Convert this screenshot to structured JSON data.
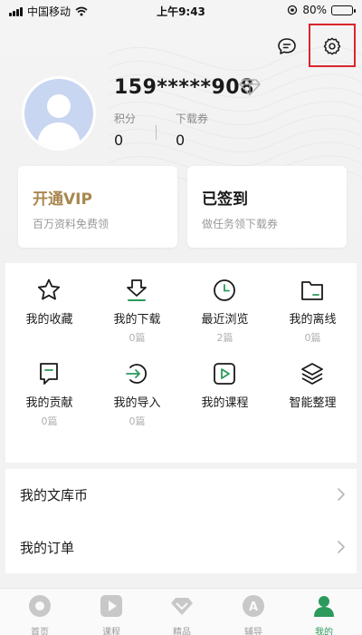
{
  "status_bar": {
    "carrier": "中国移动",
    "time": "上午9:43",
    "battery": "80%",
    "battery_fraction": 0.8
  },
  "header": {
    "message_icon": "chat-bubble-icon",
    "settings_icon": "gear-icon"
  },
  "profile": {
    "username": "159*****908",
    "stats": [
      {
        "label": "积分",
        "value": "0"
      },
      {
        "label": "下载券",
        "value": "0"
      }
    ]
  },
  "cards": {
    "vip": {
      "title": "开通VIP",
      "subtitle": "百万资料免费领"
    },
    "signin": {
      "title": "已签到",
      "subtitle": "做任务领下载券"
    }
  },
  "grid": [
    {
      "name": "我的收藏",
      "count": "",
      "icon": "star-icon"
    },
    {
      "name": "我的下载",
      "count": "0篇",
      "icon": "download-icon"
    },
    {
      "name": "最近浏览",
      "count": "2篇",
      "icon": "clock-icon"
    },
    {
      "name": "我的离线",
      "count": "0篇",
      "icon": "folder-icon"
    },
    {
      "name": "我的贡献",
      "count": "0篇",
      "icon": "contribution-icon"
    },
    {
      "name": "我的导入",
      "count": "0篇",
      "icon": "import-icon"
    },
    {
      "name": "我的课程",
      "count": "",
      "icon": "play-icon"
    },
    {
      "name": "智能整理",
      "count": "",
      "icon": "layers-icon"
    }
  ],
  "list": [
    {
      "label": "我的文库币"
    },
    {
      "label": "我的订单"
    }
  ],
  "tabs": [
    {
      "label": "首页",
      "icon": "home-icon",
      "active": false
    },
    {
      "label": "课程",
      "icon": "course-icon",
      "active": false
    },
    {
      "label": "精品",
      "icon": "diamond-icon",
      "active": false
    },
    {
      "label": "辅导",
      "icon": "tutor-icon",
      "active": false
    },
    {
      "label": "我的",
      "icon": "profile-icon",
      "active": true
    }
  ],
  "colors": {
    "accent": "#2c9a5c",
    "vip_gold": "#a8874d",
    "highlight": "#d9262c"
  }
}
